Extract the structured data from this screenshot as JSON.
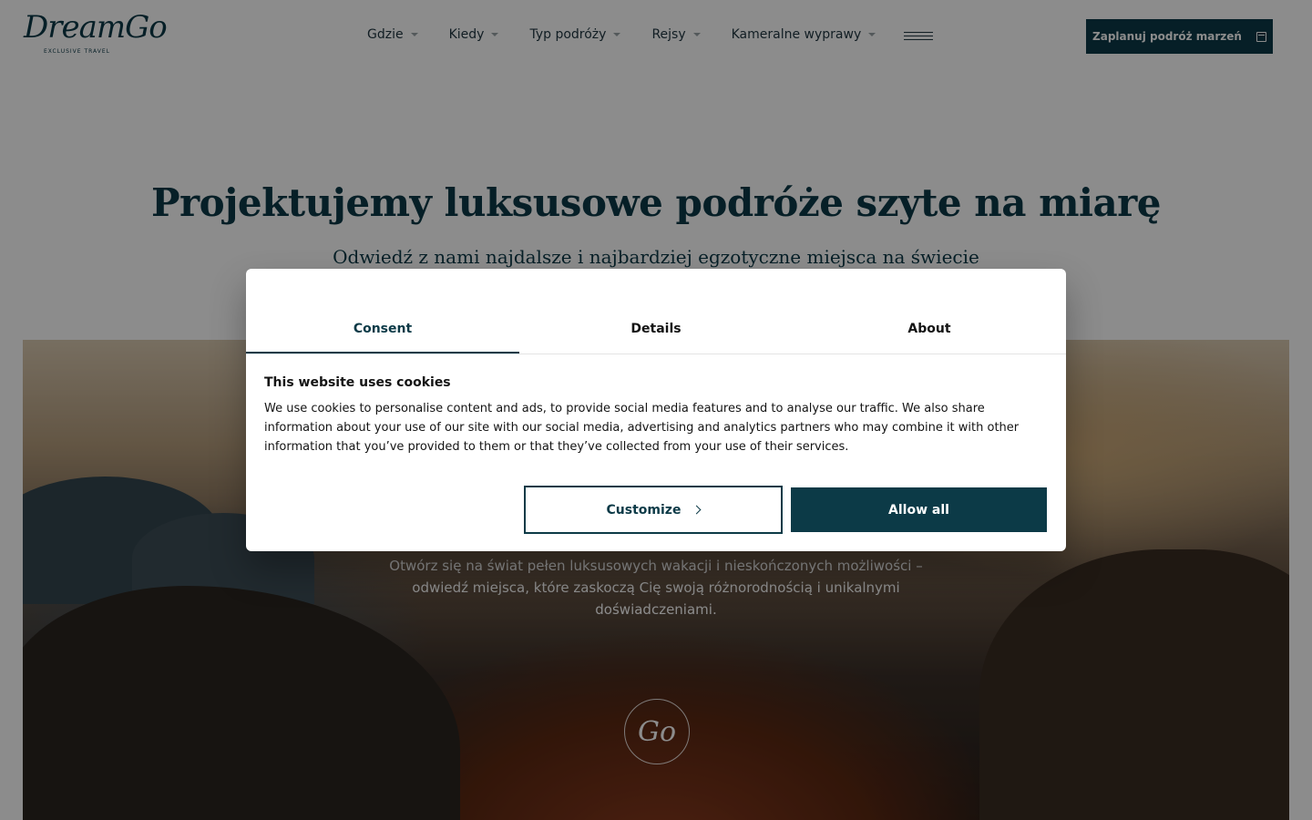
{
  "header": {
    "logo_text": "DreamGo",
    "logo_sub": "EXCLUSIVE TRAVEL",
    "nav": [
      {
        "label": "Gdzie"
      },
      {
        "label": "Kiedy"
      },
      {
        "label": "Typ podróży"
      },
      {
        "label": "Rejsy"
      },
      {
        "label": "Kameralne wyprawy"
      }
    ],
    "menu_icon": "hamburger-icon",
    "cta_label": "Zaplanuj podróż marzeń",
    "cta_icon": "calendar-icon"
  },
  "hero": {
    "title": "Projektujemy luksusowe podróże szyte na miarę",
    "subtitle": "Odwiedź z nami najdalsze i najbardziej egzotyczne miejsca na świecie",
    "photo_text": "Otwórz się na świat pełen luksusowych wakacji i nieskończonych możliwości – odwiedź miejsca, które zaskoczą Cię swoją różnorodnością i unikalnymi doświadczeniami.",
    "photo_logo": "Go"
  },
  "cookie_dialog": {
    "tabs": [
      {
        "label": "Consent",
        "active": true
      },
      {
        "label": "Details",
        "active": false
      },
      {
        "label": "About",
        "active": false
      }
    ],
    "title": "This website uses cookies",
    "text": "We use cookies to personalise content and ads, to provide social media features and to analyse our traffic. We also share information about your use of our site with our social media, advertising and analytics partners who may combine it with other information that you’ve provided to them or that they’ve collected from your use of their services.",
    "customize_label": "Customize",
    "allow_label": "Allow all"
  },
  "colors": {
    "brand": "#0c3a47",
    "overlay": "rgba(0,0,0,0.45)"
  }
}
